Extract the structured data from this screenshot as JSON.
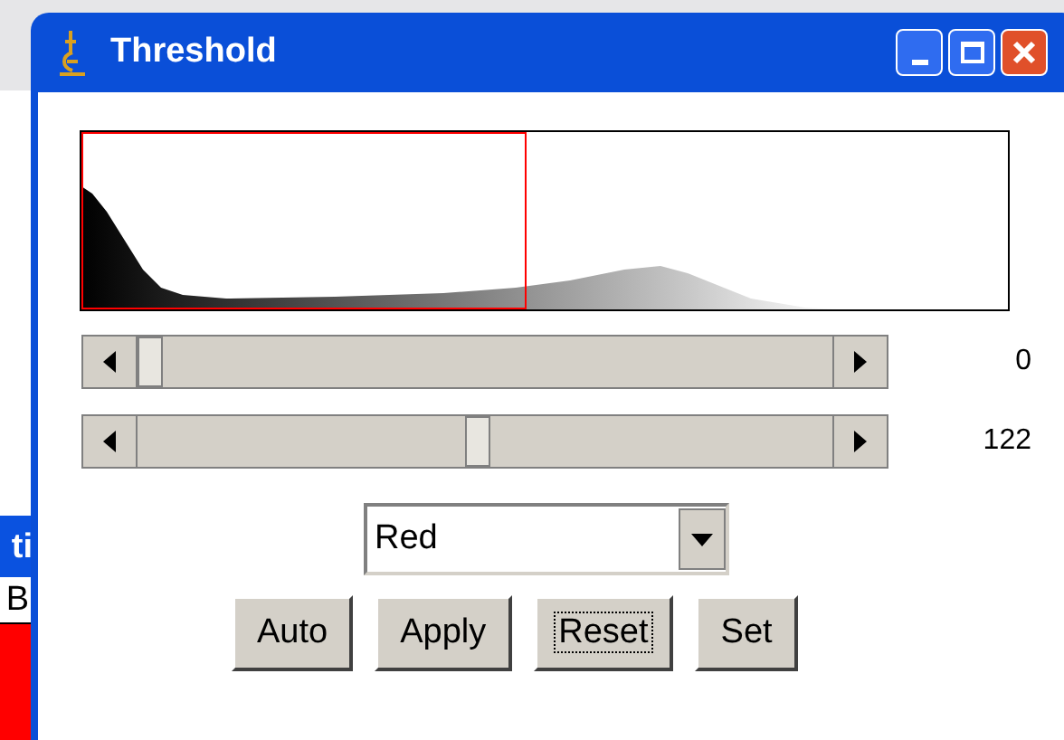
{
  "background_window": {
    "title": "ti",
    "field": "B"
  },
  "window": {
    "title": "Threshold"
  },
  "sliders": [
    {
      "level": 0,
      "reading": "0"
    },
    {
      "level": 0.47,
      "reading": "122"
    }
  ],
  "channel_dropdown": {
    "value": "Red"
  },
  "buttons": [
    {
      "label": "Auto",
      "focused": false
    },
    {
      "label": "Apply",
      "focused": false
    },
    {
      "label": "Reset",
      "focused": true
    },
    {
      "label": "Set",
      "focused": false
    }
  ]
}
